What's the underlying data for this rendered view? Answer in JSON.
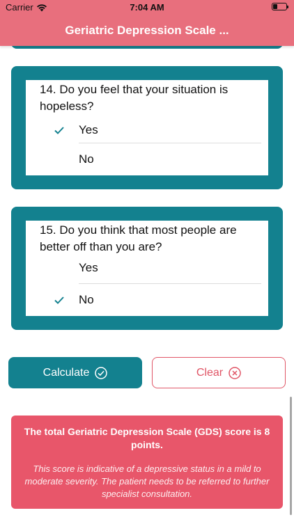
{
  "status_bar": {
    "carrier": "Carrier",
    "time": "7:04 AM"
  },
  "nav": {
    "title": "Geriatric Depression Scale ..."
  },
  "questions": [
    {
      "text": "14. Do you feel that your situation is hopeless?",
      "options": [
        {
          "label": "Yes",
          "selected": true
        },
        {
          "label": "No",
          "selected": false
        }
      ]
    },
    {
      "text": "15. Do you think that most people are better off than you are?",
      "options": [
        {
          "label": "Yes",
          "selected": false
        },
        {
          "label": "No",
          "selected": true
        }
      ]
    }
  ],
  "buttons": {
    "calculate": "Calculate",
    "clear": "Clear"
  },
  "result": {
    "score_text": "The total Geriatric Depression Scale (GDS) score is 8 points.",
    "description": "This score is indicative of a depressive status in a mild to moderate severity. The patient needs to be referred to further specialist consultation."
  },
  "colors": {
    "accent_teal": "#13818f",
    "nav_pink": "#e86f7d",
    "result_red": "#e8566a"
  }
}
